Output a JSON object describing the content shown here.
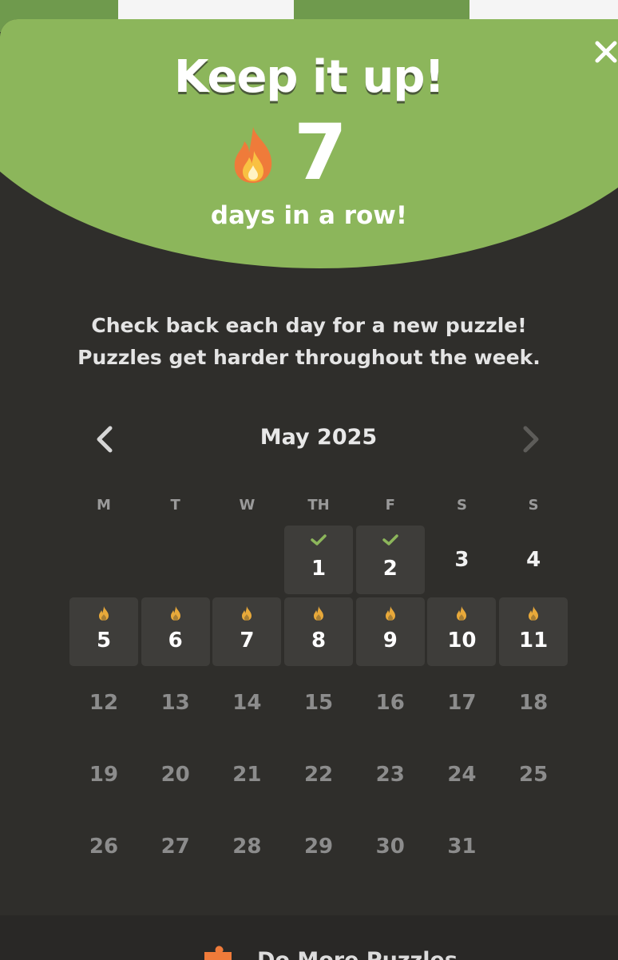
{
  "modal": {
    "title": "Keep it up!",
    "streak_count": "7",
    "streak_label": "days in a row!",
    "info_line1": "Check back each day for a new puzzle!",
    "info_line2": "Puzzles get harder throughout the week.",
    "close_icon": "close-icon",
    "streak_icon": "flame-icon"
  },
  "calendar": {
    "month_label": "May 2025",
    "prev_icon": "chevron-left-icon",
    "next_icon": "chevron-right-icon",
    "weekdays": [
      "M",
      "T",
      "W",
      "TH",
      "F",
      "S",
      "S"
    ],
    "days": [
      {
        "label": "",
        "status": "empty"
      },
      {
        "label": "",
        "status": "empty"
      },
      {
        "label": "",
        "status": "empty"
      },
      {
        "label": "1",
        "status": "solved"
      },
      {
        "label": "2",
        "status": "solved"
      },
      {
        "label": "3",
        "status": "open"
      },
      {
        "label": "4",
        "status": "open"
      },
      {
        "label": "5",
        "status": "streak"
      },
      {
        "label": "6",
        "status": "streak"
      },
      {
        "label": "7",
        "status": "streak"
      },
      {
        "label": "8",
        "status": "streak"
      },
      {
        "label": "9",
        "status": "streak"
      },
      {
        "label": "10",
        "status": "streak"
      },
      {
        "label": "11",
        "status": "streak"
      },
      {
        "label": "12",
        "status": "future"
      },
      {
        "label": "13",
        "status": "future"
      },
      {
        "label": "14",
        "status": "future"
      },
      {
        "label": "15",
        "status": "future"
      },
      {
        "label": "16",
        "status": "future"
      },
      {
        "label": "17",
        "status": "future"
      },
      {
        "label": "18",
        "status": "future"
      },
      {
        "label": "19",
        "status": "future"
      },
      {
        "label": "20",
        "status": "future"
      },
      {
        "label": "21",
        "status": "future"
      },
      {
        "label": "22",
        "status": "future"
      },
      {
        "label": "23",
        "status": "future"
      },
      {
        "label": "24",
        "status": "future"
      },
      {
        "label": "25",
        "status": "future"
      },
      {
        "label": "26",
        "status": "future"
      },
      {
        "label": "27",
        "status": "future"
      },
      {
        "label": "28",
        "status": "future"
      },
      {
        "label": "29",
        "status": "future"
      },
      {
        "label": "30",
        "status": "future"
      },
      {
        "label": "31",
        "status": "future"
      }
    ]
  },
  "footer": {
    "label": "Do More Puzzles",
    "icon": "puzzle-piece-icon"
  },
  "colors": {
    "banner": "#8cb65b",
    "background": "#2f2e2b",
    "solved_cell": "#3e3d3a",
    "check": "#8cb65b",
    "flame": "#e8a93a"
  }
}
